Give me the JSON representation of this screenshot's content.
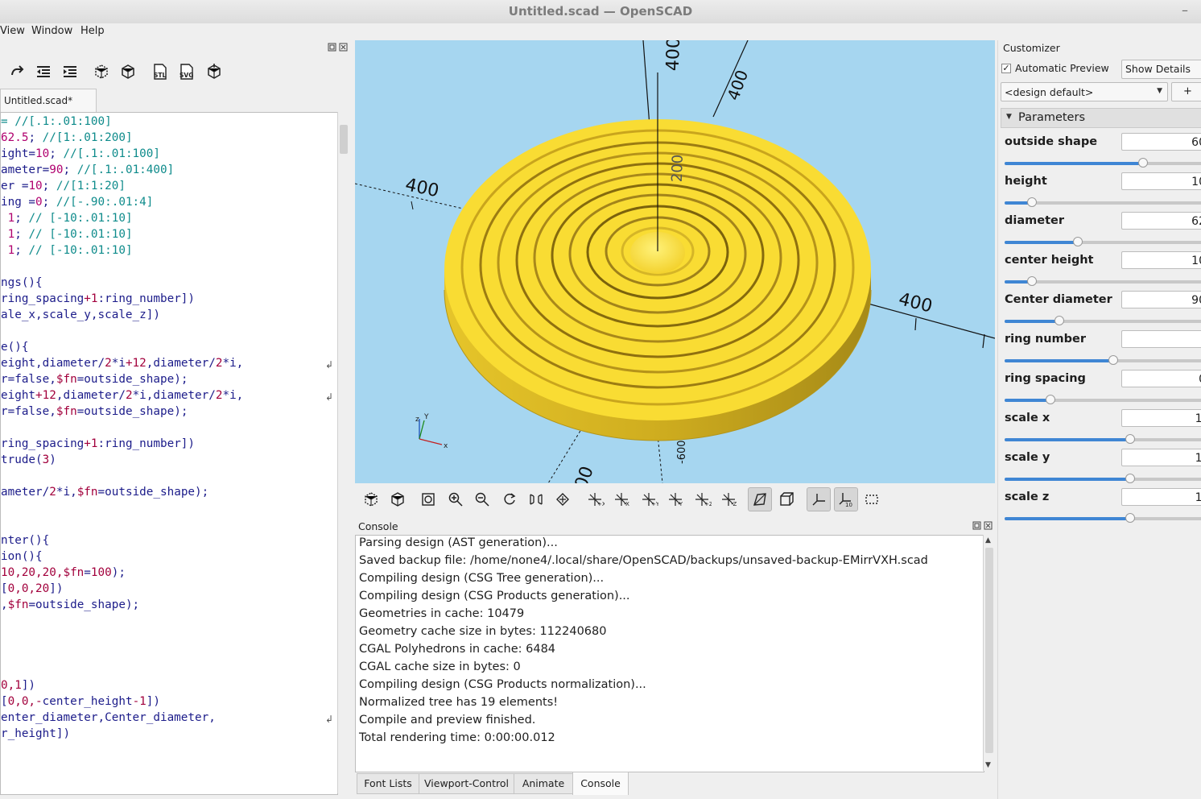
{
  "window": {
    "title": "Untitled.scad — OpenSCAD",
    "minimize_glyph": "–"
  },
  "menu": {
    "items": [
      "View",
      "Window",
      "Help"
    ]
  },
  "editor": {
    "tab_label": "Untitled.scad*",
    "code_lines": [
      [
        {
          "t": "= //[.1:.01:100]",
          "c": "c-c"
        }
      ],
      [
        {
          "t": "62.5",
          "c": "c-n"
        },
        {
          "t": "; ",
          "c": "c-d"
        },
        {
          "t": "//[1:.01:200]",
          "c": "c-c"
        }
      ],
      [
        {
          "t": "ight=",
          "c": "c-d"
        },
        {
          "t": "10",
          "c": "c-n"
        },
        {
          "t": "; ",
          "c": "c-d"
        },
        {
          "t": "//[.1:.01:100]",
          "c": "c-c"
        }
      ],
      [
        {
          "t": "ameter=",
          "c": "c-d"
        },
        {
          "t": "90",
          "c": "c-n"
        },
        {
          "t": "; ",
          "c": "c-d"
        },
        {
          "t": "//[.1:.01:400]",
          "c": "c-c"
        }
      ],
      [
        {
          "t": "er =",
          "c": "c-d"
        },
        {
          "t": "10",
          "c": "c-n"
        },
        {
          "t": "; ",
          "c": "c-d"
        },
        {
          "t": "//[1:1:20]",
          "c": "c-c"
        }
      ],
      [
        {
          "t": "ing =",
          "c": "c-d"
        },
        {
          "t": "0",
          "c": "c-n"
        },
        {
          "t": "; ",
          "c": "c-d"
        },
        {
          "t": "//[-.90:.01:4]",
          "c": "c-c"
        }
      ],
      [
        {
          "t": " 1",
          "c": "c-n"
        },
        {
          "t": "; ",
          "c": "c-d"
        },
        {
          "t": "// [-10:.01:10]",
          "c": "c-c"
        }
      ],
      [
        {
          "t": " 1",
          "c": "c-n"
        },
        {
          "t": "; ",
          "c": "c-d"
        },
        {
          "t": "// [-10:.01:10]",
          "c": "c-c"
        }
      ],
      [
        {
          "t": " 1",
          "c": "c-n"
        },
        {
          "t": "; ",
          "c": "c-d"
        },
        {
          "t": "// [-10:.01:10]",
          "c": "c-c"
        }
      ],
      [],
      [
        {
          "t": "ngs(){",
          "c": "c-d"
        }
      ],
      [
        {
          "t": "ring_spacing",
          "c": "c-d"
        },
        {
          "t": "+1",
          "c": "c-r"
        },
        {
          "t": ":ring_number])",
          "c": "c-d"
        }
      ],
      [
        {
          "t": "ale_x,scale_y,scale_z])",
          "c": "c-d"
        }
      ],
      [],
      [
        {
          "t": "e(){",
          "c": "c-d"
        }
      ],
      [
        {
          "t": "eight,diameter/",
          "c": "c-d"
        },
        {
          "t": "2",
          "c": "c-r"
        },
        {
          "t": "*i",
          "c": "c-d"
        },
        {
          "t": "+12",
          "c": "c-r"
        },
        {
          "t": ",diameter/",
          "c": "c-d"
        },
        {
          "t": "2",
          "c": "c-r"
        },
        {
          "t": "*i,",
          "c": "c-d"
        }
      ],
      [
        {
          "t": "r=false,",
          "c": "c-d"
        },
        {
          "t": "$fn",
          "c": "c-r"
        },
        {
          "t": "=outside_shape);",
          "c": "c-d"
        }
      ],
      [
        {
          "t": "eight",
          "c": "c-d"
        },
        {
          "t": "+12",
          "c": "c-r"
        },
        {
          "t": ",diameter/",
          "c": "c-d"
        },
        {
          "t": "2",
          "c": "c-r"
        },
        {
          "t": "*i,diameter/",
          "c": "c-d"
        },
        {
          "t": "2",
          "c": "c-r"
        },
        {
          "t": "*i,",
          "c": "c-d"
        }
      ],
      [
        {
          "t": "r=false,",
          "c": "c-d"
        },
        {
          "t": "$fn",
          "c": "c-r"
        },
        {
          "t": "=outside_shape);",
          "c": "c-d"
        }
      ],
      [],
      [
        {
          "t": "ring_spacing",
          "c": "c-d"
        },
        {
          "t": "+1",
          "c": "c-r"
        },
        {
          "t": ":ring_number])",
          "c": "c-d"
        }
      ],
      [
        {
          "t": "trude(",
          "c": "c-d"
        },
        {
          "t": "3",
          "c": "c-r"
        },
        {
          "t": ")",
          "c": "c-d"
        }
      ],
      [],
      [
        {
          "t": "ameter/",
          "c": "c-d"
        },
        {
          "t": "2",
          "c": "c-r"
        },
        {
          "t": "*i,",
          "c": "c-d"
        },
        {
          "t": "$fn",
          "c": "c-r"
        },
        {
          "t": "=outside_shape);",
          "c": "c-d"
        }
      ],
      [],
      [],
      [
        {
          "t": "nter(){",
          "c": "c-d"
        }
      ],
      [
        {
          "t": "ion(){",
          "c": "c-d"
        }
      ],
      [
        {
          "t": "10,20,20,",
          "c": "c-r"
        },
        {
          "t": "$fn",
          "c": "c-r"
        },
        {
          "t": "=",
          "c": "c-d"
        },
        {
          "t": "100",
          "c": "c-r"
        },
        {
          "t": ");",
          "c": "c-d"
        }
      ],
      [
        {
          "t": "[",
          "c": "c-d"
        },
        {
          "t": "0,0,20",
          "c": "c-r"
        },
        {
          "t": "])",
          "c": "c-d"
        }
      ],
      [
        {
          "t": ",",
          "c": "c-d"
        },
        {
          "t": "$fn",
          "c": "c-r"
        },
        {
          "t": "=outside_shape);",
          "c": "c-d"
        }
      ],
      [],
      [],
      [],
      [],
      [
        {
          "t": "0,1",
          "c": "c-r"
        },
        {
          "t": "])",
          "c": "c-d"
        }
      ],
      [
        {
          "t": "[",
          "c": "c-d"
        },
        {
          "t": "0,0,-",
          "c": "c-r"
        },
        {
          "t": "center_height",
          "c": "c-d"
        },
        {
          "t": "-1",
          "c": "c-r"
        },
        {
          "t": "])",
          "c": "c-d"
        }
      ],
      [
        {
          "t": "enter_diameter,Center_diameter,",
          "c": "c-d"
        }
      ],
      [
        {
          "t": "r_height])",
          "c": "c-d"
        }
      ]
    ]
  },
  "viewport": {
    "axis_labels": [
      "400",
      "400",
      "400",
      "400",
      "200",
      "00",
      "-600"
    ],
    "gizmo": {
      "z": "z",
      "y": "Y",
      "x": "x"
    },
    "colors": {
      "background": "#a6d6f0",
      "object": "#f9dc33"
    }
  },
  "console": {
    "title": "Console",
    "lines": [
      "Parsing design (AST generation)...",
      "Saved backup file: /home/none4/.local/share/OpenSCAD/backups/unsaved-backup-EMirrVXH.scad",
      "Compiling design (CSG Tree generation)...",
      "Compiling design (CSG Products generation)...",
      "Geometries in cache: 10479",
      "Geometry cache size in bytes: 112240680",
      "CGAL Polyhedrons in cache: 6484",
      "CGAL cache size in bytes: 0",
      "Compiling design (CSG Products normalization)...",
      "Normalized tree has 19 elements!",
      "Compile and preview finished.",
      "Total rendering time: 0:00:00.012"
    ]
  },
  "bottom_tabs": [
    "Font Lists",
    "Viewport-Control",
    "Animate",
    "Console"
  ],
  "customizer": {
    "title": "Customizer",
    "automatic_preview": "Automatic Preview",
    "show_details": "Show Details",
    "preset": "<design default>",
    "add_button": "+",
    "section": "Parameters",
    "params": [
      {
        "label": "outside shape",
        "value": "60",
        "slider": 0.66
      },
      {
        "label": "height",
        "value": "10",
        "slider": 0.13
      },
      {
        "label": "diameter",
        "value": "62",
        "slider": 0.35
      },
      {
        "label": "center height",
        "value": "10",
        "slider": 0.13
      },
      {
        "label": "Center diameter",
        "value": "90",
        "slider": 0.26
      },
      {
        "label": "ring number",
        "value": "",
        "slider": 0.52
      },
      {
        "label": "ring spacing",
        "value": "0",
        "slider": 0.22
      },
      {
        "label": "scale x",
        "value": "1.",
        "slider": 0.6
      },
      {
        "label": "scale y",
        "value": "1.",
        "slider": 0.6
      },
      {
        "label": "scale z",
        "value": "1.",
        "slider": 0.6
      }
    ]
  }
}
